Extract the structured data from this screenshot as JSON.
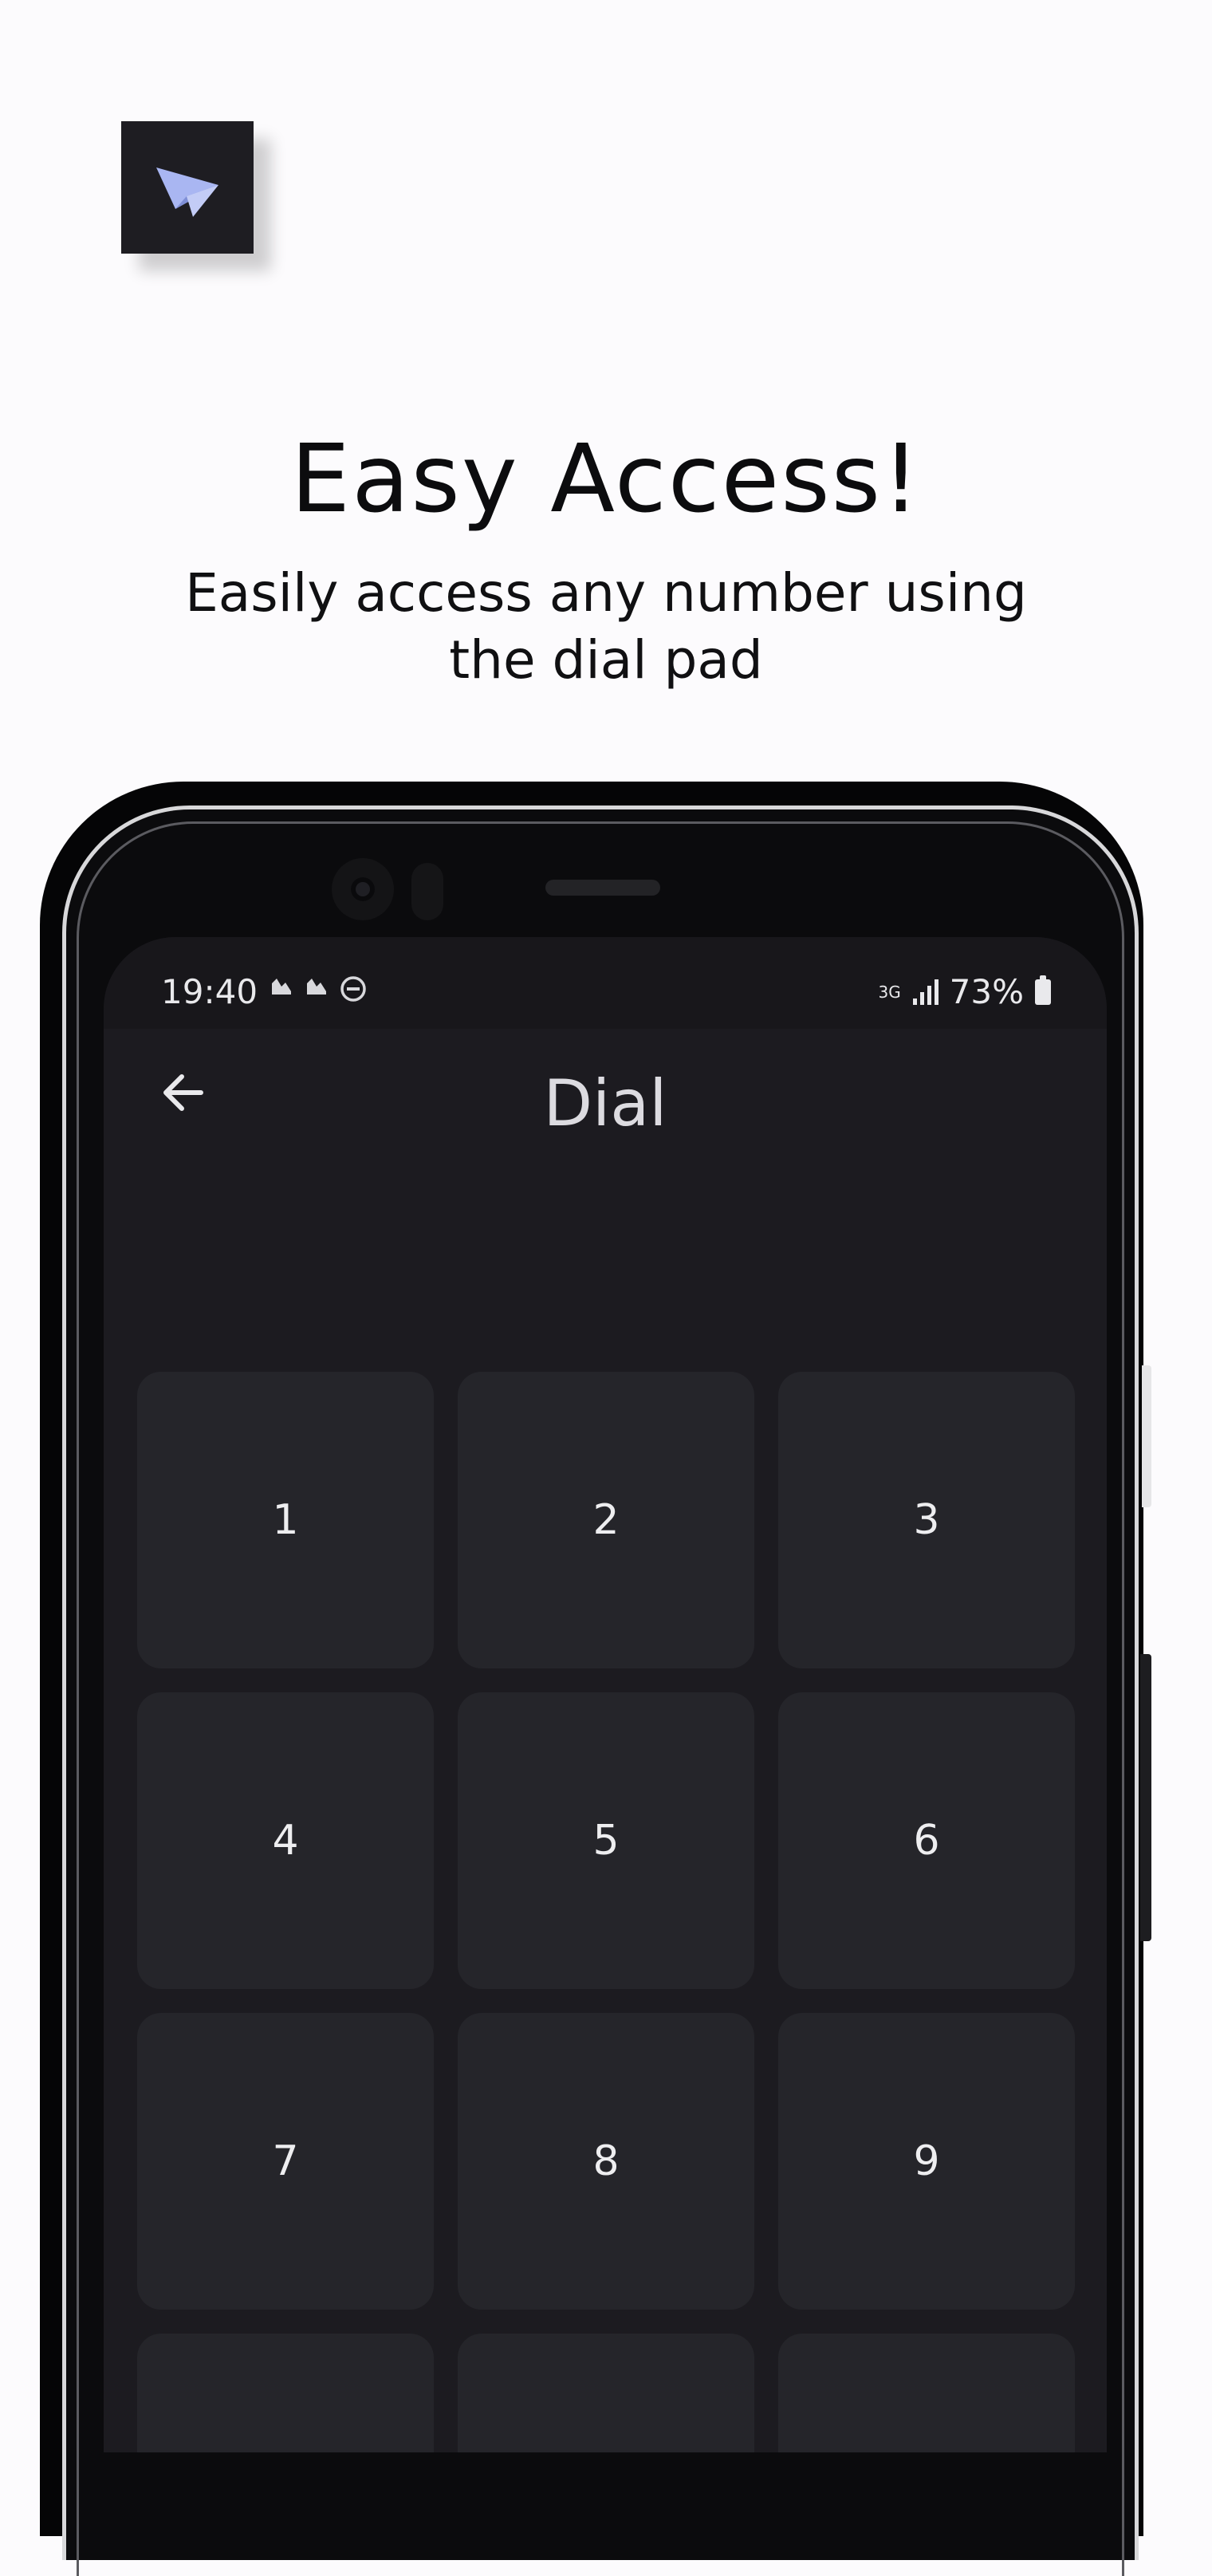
{
  "header": {
    "title": "Easy Access!",
    "subtitle_line_1": "Easily access any number using",
    "subtitle_line_2": "the dial pad",
    "logo_icon": "paper-plane-icon"
  },
  "status_bar": {
    "time": "19:40",
    "left_icons": [
      "notification-icon",
      "notification-icon",
      "do-not-disturb-icon"
    ],
    "network_type": "3G",
    "battery_percent": "73%"
  },
  "app_bar": {
    "title": "Dial",
    "back_icon": "arrow-left-icon"
  },
  "keypad": {
    "keys": [
      "1",
      "2",
      "3",
      "4",
      "5",
      "6",
      "7",
      "8",
      "9",
      "",
      "",
      ""
    ]
  },
  "colors": {
    "page_background": "#fcfbfd",
    "screen_background": "#1c1b20",
    "key_background": "#25252a",
    "logo_background": "#1e1d22",
    "logo_accent": "#a9b6f2"
  }
}
